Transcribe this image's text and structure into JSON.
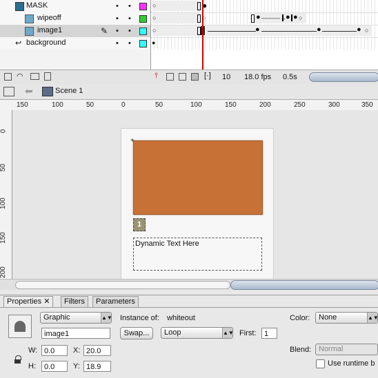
{
  "timeline": {
    "layers": [
      {
        "name": "MASK",
        "color": "#ff33ff"
      },
      {
        "name": "wipeoff",
        "color": "#33cc33"
      },
      {
        "name": "image1",
        "color": "#33ffff"
      },
      {
        "name": "background",
        "color": "#33ffff"
      }
    ],
    "frame_number": "10",
    "fps": "18.0 fps",
    "time": "0.5s"
  },
  "editbar": {
    "scene": "Scene 1"
  },
  "rulers": {
    "horizontal": [
      "150",
      "100",
      "50",
      "0",
      "50",
      "100",
      "150",
      "200",
      "250",
      "300",
      "350"
    ],
    "vertical": [
      "0",
      "50",
      "100",
      "150",
      "200"
    ]
  },
  "stage": {
    "badge": "1",
    "dynamic_text": "Dynamic Text Here"
  },
  "properties": {
    "tabs": [
      "Properties",
      "Filters",
      "Parameters"
    ],
    "symbol_type": "Graphic",
    "instance_label": "Instance of:",
    "instance_of": "whiteout",
    "instance_name": "image1",
    "swap_label": "Swap...",
    "loop": "Loop",
    "first_label": "First:",
    "first": "1",
    "w_label": "W:",
    "w": "0.0",
    "x_label": "X:",
    "x": "20.0",
    "h_label": "H:",
    "h": "0.0",
    "y_label": "Y:",
    "y": "18.9",
    "color_label": "Color:",
    "color": "None",
    "blend_label": "Blend:",
    "blend": "Normal",
    "runtime_label": "Use runtime b"
  }
}
